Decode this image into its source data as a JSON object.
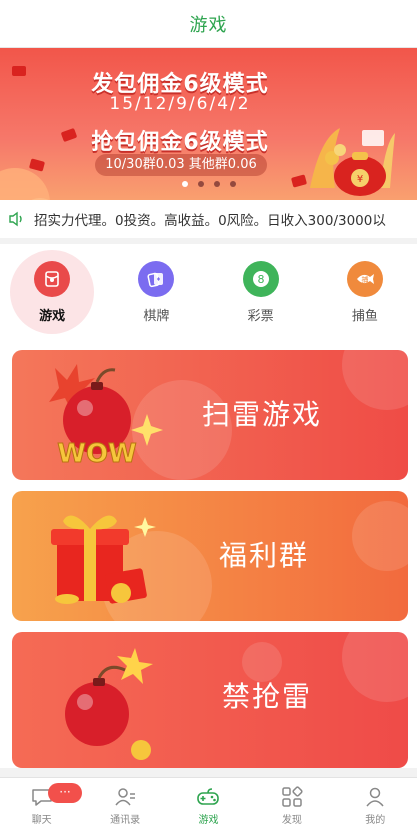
{
  "header": {
    "title": "游戏"
  },
  "banner": {
    "line1": "发包佣金6级模式",
    "line2": "15/12/9/6/4/2",
    "line3": "抢包佣金6级模式",
    "line4": "10/30群0.03 其他群0.06",
    "page_count": 4,
    "active_page": 1
  },
  "notice": {
    "icon": "speaker-icon",
    "text": "招实力代理。0投资。高收益。0风险。日收入300/3000以"
  },
  "categories": [
    {
      "label": "游戏",
      "icon": "red-packet-icon",
      "color": "#e94a4a",
      "active": true
    },
    {
      "label": "棋牌",
      "icon": "cards-icon",
      "color": "#7b6cf0",
      "active": false
    },
    {
      "label": "彩票",
      "icon": "lottery-ball-icon",
      "color": "#3fb45a",
      "active": false
    },
    {
      "label": "捕鱼",
      "icon": "fish-icon",
      "color": "#f08a3c",
      "active": false
    }
  ],
  "cards": [
    {
      "title": "扫雷游戏",
      "art": "bomb-wow-icon"
    },
    {
      "title": "福利群",
      "art": "gift-box-icon"
    },
    {
      "title": "禁抢雷",
      "art": "bomb-icon"
    }
  ],
  "tabbar": {
    "items": [
      {
        "label": "聊天",
        "icon": "chat-icon",
        "badge": "···",
        "active": false
      },
      {
        "label": "通讯录",
        "icon": "contacts-icon",
        "active": false
      },
      {
        "label": "游戏",
        "icon": "gamepad-icon",
        "active": true
      },
      {
        "label": "发现",
        "icon": "discover-icon",
        "active": false
      },
      {
        "label": "我的",
        "icon": "profile-icon",
        "active": false
      }
    ]
  },
  "colors": {
    "accent_green": "#2ea44f",
    "badge_red": "#f2504b"
  }
}
